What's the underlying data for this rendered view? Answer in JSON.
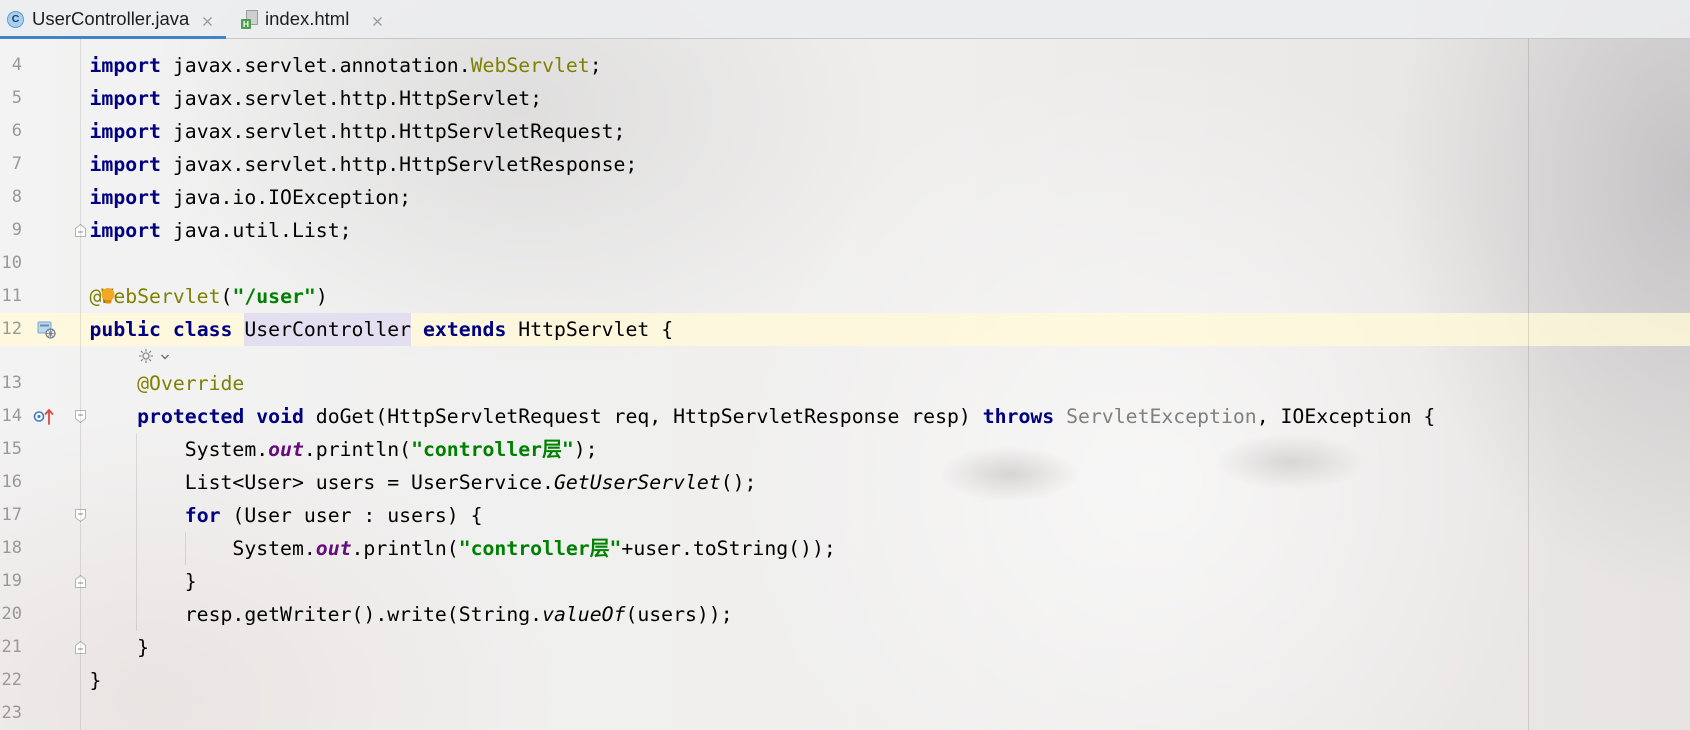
{
  "tabs": [
    {
      "label": "UserController.java",
      "icon": "java-class-icon",
      "icon_letter": "C",
      "active": true
    },
    {
      "label": "index.html",
      "icon": "html-file-icon",
      "icon_letter": "H",
      "active": false
    }
  ],
  "editor": {
    "current_line": "12",
    "lines": [
      {
        "number": "4",
        "tokens": [
          {
            "type": "keyword",
            "text": "import"
          },
          {
            "type": "plain",
            "text": " javax.servlet.annotation."
          },
          {
            "type": "annotation",
            "text": "WebServlet"
          },
          {
            "type": "plain",
            "text": ";"
          }
        ]
      },
      {
        "number": "5",
        "tokens": [
          {
            "type": "keyword",
            "text": "import"
          },
          {
            "type": "plain",
            "text": " javax.servlet.http.HttpServlet;"
          }
        ]
      },
      {
        "number": "6",
        "tokens": [
          {
            "type": "keyword",
            "text": "import"
          },
          {
            "type": "plain",
            "text": " javax.servlet.http.HttpServletRequest;"
          }
        ]
      },
      {
        "number": "7",
        "tokens": [
          {
            "type": "keyword",
            "text": "import"
          },
          {
            "type": "plain",
            "text": " javax.servlet.http.HttpServletResponse;"
          }
        ]
      },
      {
        "number": "8",
        "tokens": [
          {
            "type": "keyword",
            "text": "import"
          },
          {
            "type": "plain",
            "text": " java.io.IOException;"
          }
        ]
      },
      {
        "number": "9",
        "fold": "end",
        "tokens": [
          {
            "type": "keyword",
            "text": "import"
          },
          {
            "type": "plain",
            "text": " java.util.List;"
          }
        ]
      },
      {
        "number": "10",
        "tokens": []
      },
      {
        "number": "11",
        "intention_icon": "intention-bulb-icon",
        "tokens": [
          {
            "type": "annotation",
            "text": "@WebServlet"
          },
          {
            "type": "plain",
            "text": "("
          },
          {
            "type": "string",
            "text": "\"/user\""
          },
          {
            "type": "plain",
            "text": ")"
          }
        ]
      },
      {
        "number": "12",
        "gutter_icons": [
          "web-servlet-gutter-icon"
        ],
        "tokens": [
          {
            "type": "keyword",
            "text": "public"
          },
          {
            "type": "plain",
            "text": " "
          },
          {
            "type": "keyword",
            "text": "class"
          },
          {
            "type": "plain",
            "text": " "
          },
          {
            "type": "class-name",
            "text": "UserController",
            "caret_highlight": true
          },
          {
            "type": "plain",
            "text": " "
          },
          {
            "type": "keyword",
            "text": "extends"
          },
          {
            "type": "plain",
            "text": " HttpServlet {"
          }
        ]
      },
      {
        "inlay": true,
        "icons": [
          "inlay-hint-icon",
          "chevron-down-icon"
        ]
      },
      {
        "number": "13",
        "tokens": [
          {
            "type": "plain",
            "text": "    "
          },
          {
            "type": "annotation",
            "text": "@Override"
          }
        ]
      },
      {
        "number": "14",
        "gutter_icons": [
          "override-method-icon"
        ],
        "fold": "start",
        "tokens": [
          {
            "type": "plain",
            "text": "    "
          },
          {
            "type": "keyword",
            "text": "protected"
          },
          {
            "type": "plain",
            "text": " "
          },
          {
            "type": "keyword",
            "text": "void"
          },
          {
            "type": "plain",
            "text": " doGet(HttpServletRequest req, HttpServletResponse resp) "
          },
          {
            "type": "keyword",
            "text": "throws"
          },
          {
            "type": "plain",
            "text": " "
          },
          {
            "type": "unused",
            "text": "ServletException"
          },
          {
            "type": "plain",
            "text": ", IOException {"
          }
        ]
      },
      {
        "number": "15",
        "tokens": [
          {
            "type": "plain",
            "text": "        System."
          },
          {
            "type": "static-field",
            "text": "out"
          },
          {
            "type": "plain",
            "text": ".println("
          },
          {
            "type": "string",
            "text": "\"controller层\""
          },
          {
            "type": "plain",
            "text": ");"
          }
        ]
      },
      {
        "number": "16",
        "tokens": [
          {
            "type": "plain",
            "text": "        List<User> users = UserService."
          },
          {
            "type": "static-method",
            "text": "GetUserServlet"
          },
          {
            "type": "plain",
            "text": "();"
          }
        ]
      },
      {
        "number": "17",
        "fold": "start",
        "tokens": [
          {
            "type": "plain",
            "text": "        "
          },
          {
            "type": "keyword",
            "text": "for"
          },
          {
            "type": "plain",
            "text": " (User user : users) {"
          }
        ]
      },
      {
        "number": "18",
        "tokens": [
          {
            "type": "plain",
            "text": "            System."
          },
          {
            "type": "static-field",
            "text": "out"
          },
          {
            "type": "plain",
            "text": ".println("
          },
          {
            "type": "string",
            "text": "\"controller层\""
          },
          {
            "type": "plain",
            "text": "+user.toString());"
          }
        ]
      },
      {
        "number": "19",
        "fold": "end",
        "tokens": [
          {
            "type": "plain",
            "text": "        }"
          }
        ]
      },
      {
        "number": "20",
        "tokens": [
          {
            "type": "plain",
            "text": "        resp.getWriter().write(String."
          },
          {
            "type": "static-method",
            "text": "valueOf"
          },
          {
            "type": "plain",
            "text": "(users));"
          }
        ]
      },
      {
        "number": "21",
        "fold": "end",
        "tokens": [
          {
            "type": "plain",
            "text": "    }"
          }
        ]
      },
      {
        "number": "22",
        "tokens": [
          {
            "type": "plain",
            "text": "}"
          }
        ]
      },
      {
        "number": "23",
        "tokens": []
      }
    ]
  },
  "syntax_colors": {
    "keyword": "#000080",
    "annotation": "#808000",
    "string": "#008000",
    "static-field": "#660E7A",
    "static-method": "#000000",
    "unused": "#808080",
    "class-name": "#000000",
    "plain": "#000000"
  },
  "colors": {
    "line_number": "#999999",
    "tab_underline": "#4083C9",
    "current_line": "#FFF9D8",
    "caret_identifier": "#DCD8F5"
  }
}
